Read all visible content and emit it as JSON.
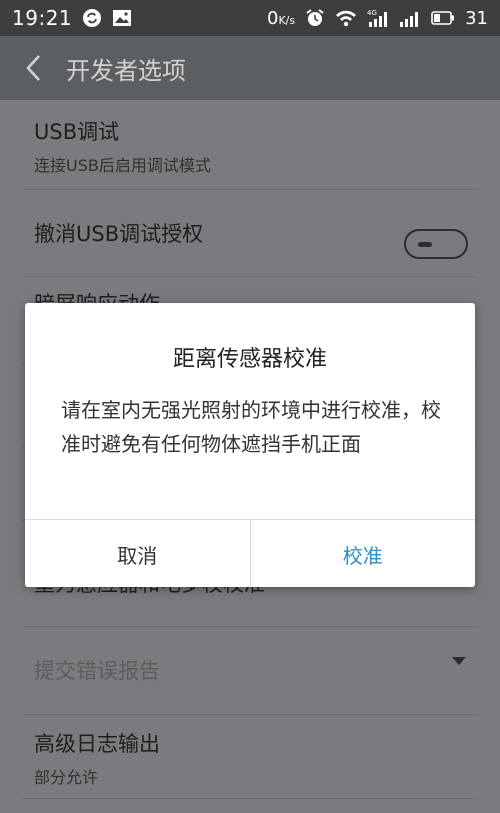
{
  "status_bar": {
    "time": "19:21",
    "net_speed": "0",
    "net_unit": "K/s",
    "network": "4G",
    "battery": "31"
  },
  "app_bar": {
    "title": "开发者选项"
  },
  "settings": {
    "usb_debug": {
      "title": "USB调试",
      "subtitle": "连接USB后启用调试模式",
      "enabled": false
    },
    "revoke_usb": {
      "title": "撤消USB调试授权"
    },
    "hidden_item": {
      "title": "暗屏响应动作"
    },
    "obscured_item": {
      "title": "重力感应器和电罗校校准"
    },
    "submit_bug": {
      "title": "提交错误报告"
    },
    "advanced_log": {
      "title": "高级日志输出",
      "subtitle": "部分允许"
    }
  },
  "dialog": {
    "title": "距离传感器校准",
    "message": "请在室内无强光照射的环境中进行校准，校准时避免有任何物体遮挡手机正面",
    "cancel_label": "取消",
    "confirm_label": "校准"
  },
  "colors": {
    "accent": "#2a8fc4"
  }
}
